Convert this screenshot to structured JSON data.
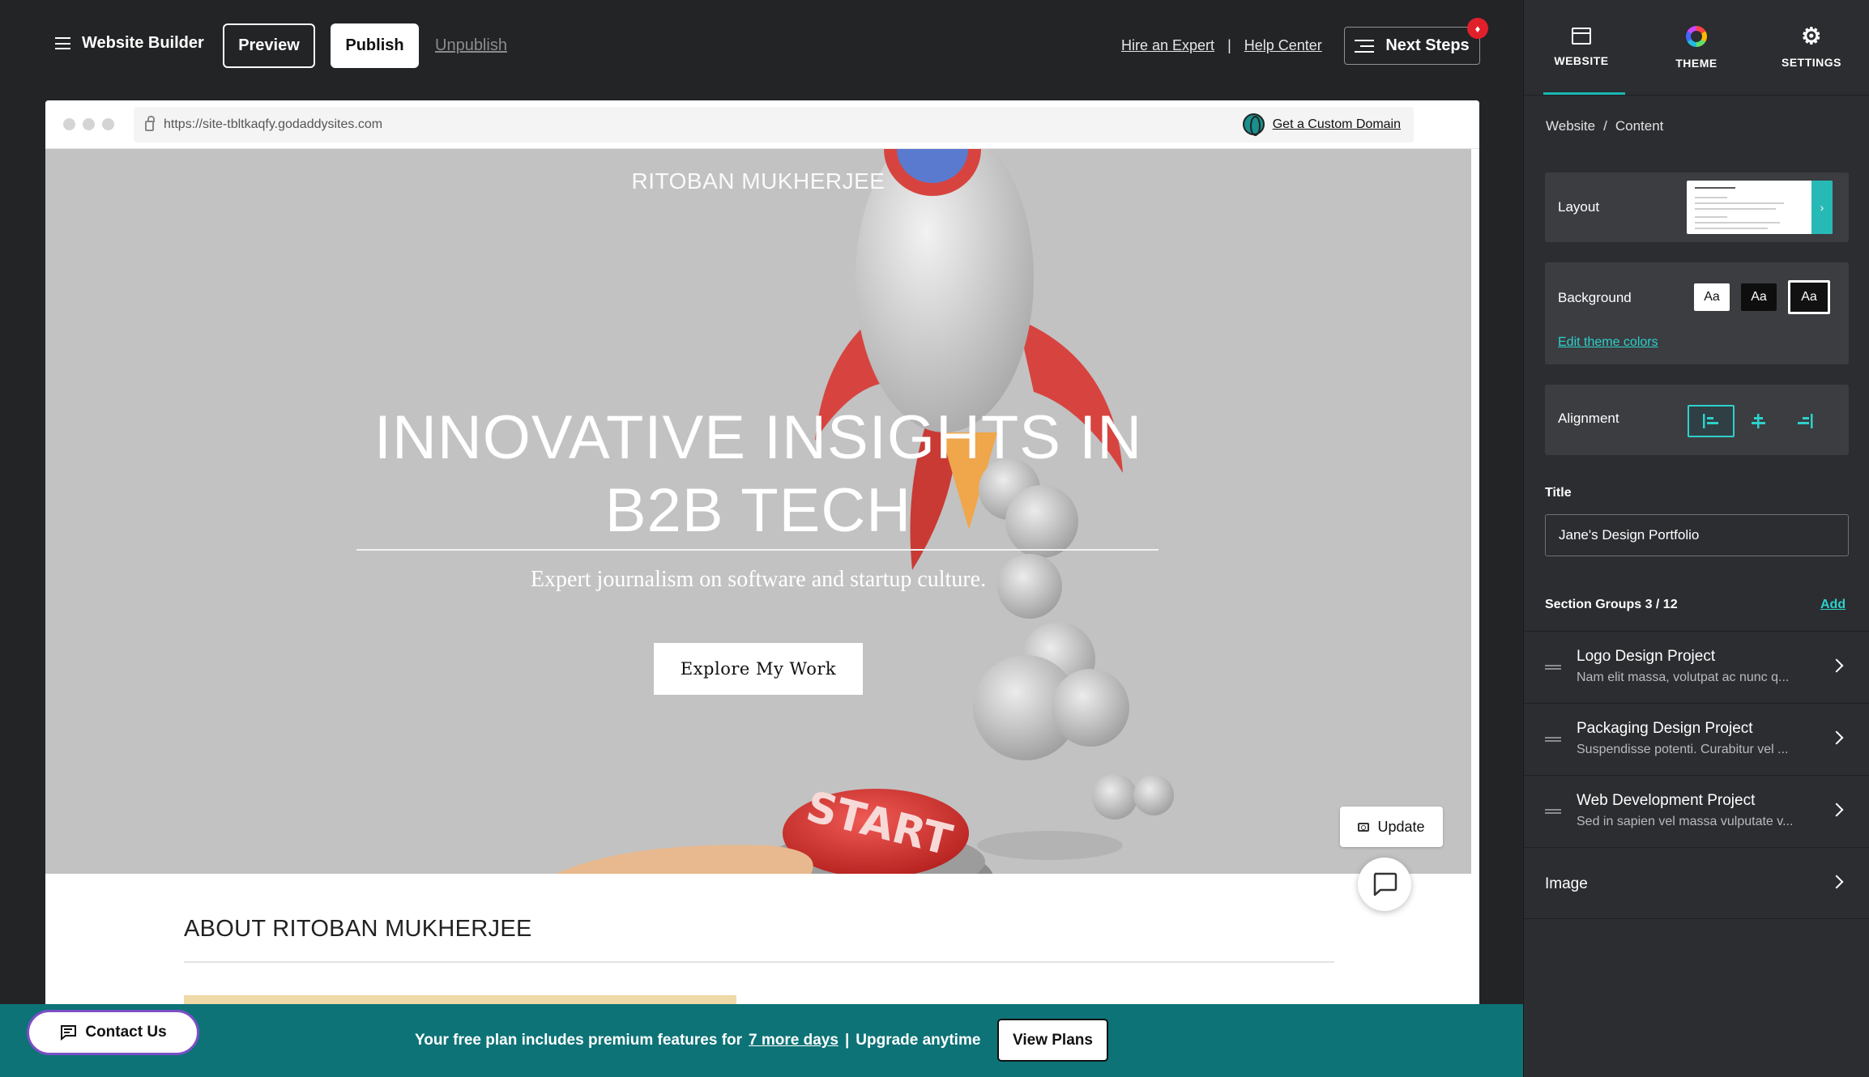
{
  "topbar": {
    "brand": "Website Builder",
    "preview": "Preview",
    "publish": "Publish",
    "unpublish": "Unpublish",
    "hire_expert": "Hire an Expert",
    "separator": "|",
    "help_center": "Help Center",
    "next_steps": "Next Steps"
  },
  "browser": {
    "url": "https://site-tbltkaqfy.godaddysites.com",
    "custom_domain": "Get a Custom Domain"
  },
  "hero": {
    "site_name": "RITOBAN MUKHERJEE",
    "title_line1": "INNOVATIVE INSIGHTS IN",
    "title_line2": "B2B TECH",
    "subtitle": "Expert journalism on software and startup culture.",
    "cta": "Explore My Work",
    "update": "Update"
  },
  "about": {
    "title": "ABOUT RITOBAN MUKHERJEE"
  },
  "promo": {
    "contact": "Contact Us",
    "text_before": "Your free plan includes premium features for",
    "days_link": "7 more days",
    "separator": "|",
    "text_after": "Upgrade anytime",
    "view_plans": "View Plans"
  },
  "panel": {
    "tabs": [
      {
        "label": "WEBSITE",
        "icon": "browser-window-icon"
      },
      {
        "label": "THEME",
        "icon": "color-wheel-icon"
      },
      {
        "label": "SETTINGS",
        "icon": "gear-icon"
      }
    ],
    "breadcrumb": [
      "Website",
      "/",
      "Content"
    ],
    "layout_label": "Layout",
    "background_label": "Background",
    "swatch_label": "Aa",
    "edit_theme_colors": "Edit theme colors",
    "alignment_label": "Alignment",
    "title_label": "Title",
    "title_value": "Jane's Design Portfolio",
    "section_groups_label": "Section Groups 3 / 12",
    "add": "Add",
    "section_groups": [
      {
        "title": "Logo Design Project",
        "desc": "Nam elit massa, volutpat ac nunc q..."
      },
      {
        "title": "Packaging Design Project",
        "desc": "Suspendisse potenti. Curabitur vel ..."
      },
      {
        "title": "Web Development Project",
        "desc": "Sed in sapien vel massa vulputate v..."
      }
    ],
    "image_label": "Image"
  },
  "colors": {
    "accent": "#19b7b3",
    "promo_bar": "#0d7377",
    "notification": "#e0202b"
  }
}
